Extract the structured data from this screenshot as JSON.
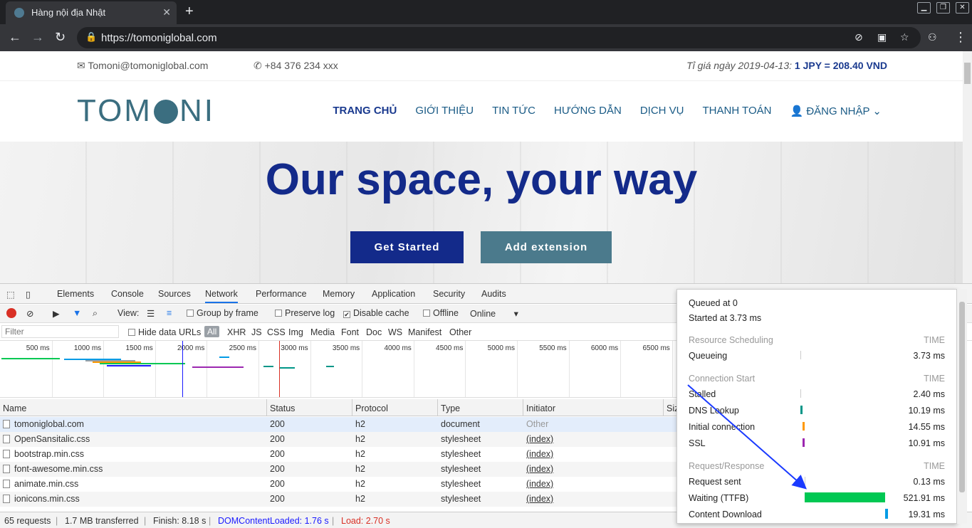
{
  "browser": {
    "tab_title": "Hàng nội địa Nhật",
    "url": "https://tomoniglobal.com"
  },
  "site": {
    "email": "Tomoni@tomoniglobal.com",
    "phone": "+84 376 234 xxx",
    "rate_label": "Tỉ giá ngày 2019-04-13:",
    "rate_value": "1 JPY = 208.40 VND",
    "logo": {
      "left": "TOM",
      "right": "NI"
    },
    "nav": [
      "TRANG CHỦ",
      "GIỚI THIỆU",
      "TIN TỨC",
      "HƯỚNG DẪN",
      "DỊCH VỤ",
      "THANH TOÁN",
      "ĐĂNG NHẬP"
    ],
    "hero_title": "Our space, your way",
    "btn_start": "Get Started",
    "btn_ext": "Add extension"
  },
  "devtools": {
    "tabs": [
      "Elements",
      "Console",
      "Sources",
      "Network",
      "Performance",
      "Memory",
      "Application",
      "Security",
      "Audits"
    ],
    "toolbar": {
      "view": "View:",
      "group_by_frame": "Group by frame",
      "preserve_log": "Preserve log",
      "disable_cache": "Disable cache",
      "offline": "Offline",
      "throttle": "Online"
    },
    "filter": {
      "placeholder": "Filter",
      "hide_data_urls": "Hide data URLs",
      "all": "All",
      "types": [
        "XHR",
        "JS",
        "CSS",
        "Img",
        "Media",
        "Font",
        "Doc",
        "WS",
        "Manifest",
        "Other"
      ]
    },
    "overview_ticks": [
      "500 ms",
      "1000 ms",
      "1500 ms",
      "2000 ms",
      "2500 ms",
      "3000 ms",
      "3500 ms",
      "4000 ms",
      "4500 ms",
      "5000 ms",
      "5500 ms",
      "6000 ms",
      "6500 ms"
    ],
    "columns": [
      "Name",
      "Status",
      "Protocol",
      "Type",
      "Initiator",
      "Siz"
    ],
    "rows": [
      {
        "name": "tomoniglobal.com",
        "status": "200",
        "protocol": "h2",
        "type": "document",
        "initiator": "Other"
      },
      {
        "name": "OpenSansitalic.css",
        "status": "200",
        "protocol": "h2",
        "type": "stylesheet",
        "initiator": "(index)"
      },
      {
        "name": "bootstrap.min.css",
        "status": "200",
        "protocol": "h2",
        "type": "stylesheet",
        "initiator": "(index)"
      },
      {
        "name": "font-awesome.min.css",
        "status": "200",
        "protocol": "h2",
        "type": "stylesheet",
        "initiator": "(index)"
      },
      {
        "name": "animate.min.css",
        "status": "200",
        "protocol": "h2",
        "type": "stylesheet",
        "initiator": "(index)"
      },
      {
        "name": "ionicons.min.css",
        "status": "200",
        "protocol": "h2",
        "type": "stylesheet",
        "initiator": "(index)"
      }
    ],
    "status": {
      "requests": "65 requests",
      "transferred": "1.7 MB transferred",
      "finish": "Finish: 8.18 s",
      "dcl": "DOMContentLoaded: 1.76 s",
      "load": "Load: 2.70 s"
    }
  },
  "timing": {
    "queued": "Queued at 0",
    "started": "Started at 3.73 ms",
    "time_label": "TIME",
    "sections": [
      {
        "title": "Resource Scheduling",
        "items": [
          {
            "label": "Queueing",
            "value": "3.73 ms"
          }
        ]
      },
      {
        "title": "Connection Start",
        "items": [
          {
            "label": "Stalled",
            "value": "2.40 ms"
          },
          {
            "label": "DNS Lookup",
            "value": "10.19 ms"
          },
          {
            "label": "Initial connection",
            "value": "14.55 ms"
          },
          {
            "label": "SSL",
            "value": "10.91 ms"
          }
        ]
      },
      {
        "title": "Request/Response",
        "items": [
          {
            "label": "Request sent",
            "value": "0.13 ms"
          },
          {
            "label": "Waiting (TTFB)",
            "value": "521.91 ms"
          },
          {
            "label": "Content Download",
            "value": "19.31 ms"
          }
        ]
      }
    ]
  },
  "colors": {
    "brand_blue": "#132a8a",
    "brand_teal": "#4b7a8c",
    "ttfb": "#00c853",
    "dns": "#009688",
    "connect": "#ff9800",
    "ssl": "#9c27b0",
    "download": "#039be5",
    "dcl": "#1a1aff",
    "load": "#d93025"
  },
  "icons": [
    "back-icon",
    "forward-icon",
    "reload-icon",
    "lock-icon",
    "bookmark-star-icon",
    "mail-icon",
    "phone-icon",
    "user-icon"
  ]
}
